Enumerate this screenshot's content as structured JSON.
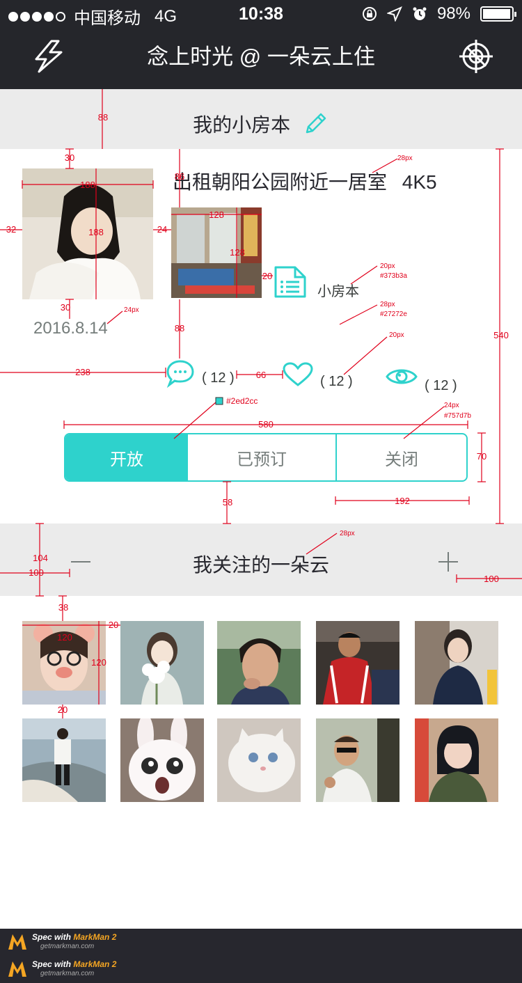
{
  "status_bar": {
    "carrier": "中国移动",
    "network": "4G",
    "time": "10:38",
    "battery": "98%",
    "battery_fraction": 0.98
  },
  "nav": {
    "title": "念上时光 @ 一朵云上住",
    "left_icon": "lightning-icon",
    "right_icon": "crosshair-icon"
  },
  "section_room": {
    "title": "我的小房本",
    "icon": "pencil-icon"
  },
  "listing": {
    "title": "出租朝阳公园附近一居室",
    "price": "4K5",
    "date": "2016.8.14",
    "doc_label": "小房本",
    "stats": {
      "comments": "( 12 )",
      "likes": "( 12 )",
      "views": "( 12 )"
    }
  },
  "segment": {
    "options": [
      "开放",
      "已预订",
      "关闭"
    ],
    "selected": "开放"
  },
  "section_follow": {
    "title": "我关注的一朵云"
  },
  "bottom_bar": {
    "label1": "Spec with",
    "brand": "MarkMan 2",
    "url": "getmarkman.com"
  },
  "spec": {
    "labels": [
      "88",
      "30",
      "188",
      "188",
      "32",
      "24",
      "30",
      "86",
      "128",
      "128",
      "20",
      "88",
      "238",
      "66",
      "580",
      "70",
      "58",
      "192",
      "540",
      "104",
      "100",
      "100",
      "38",
      "120",
      "120",
      "20",
      "20"
    ],
    "notes": [
      "28px",
      "20px",
      "#373b3a",
      "28px",
      "#27272e",
      "20px",
      "24px",
      "24px",
      "#757d7b",
      "#2ed2cc",
      "28px"
    ]
  },
  "colors": {
    "accent": "#2ed2cc",
    "dark": "#25262b",
    "text_primary": "#27272e",
    "text_secondary": "#373b3a",
    "text_muted": "#757d7b",
    "section_bg": "#ebebeb"
  }
}
